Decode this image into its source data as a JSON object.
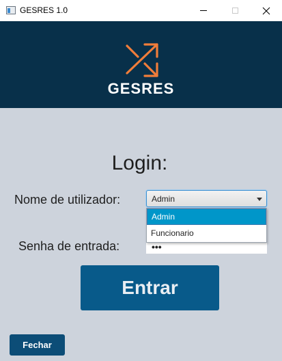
{
  "window": {
    "title": "GESRES 1.0",
    "controls": [
      "minimize-icon",
      "maximize-icon",
      "close-icon"
    ]
  },
  "header": {
    "logo_text": "GESRES",
    "logo_icon": "shuffle-arrows-icon",
    "background": "#08304a",
    "accent": "#f07d3a"
  },
  "login": {
    "title": "Login:",
    "username_label": "Nome de utilizador:",
    "username_selected": "Admin",
    "username_options": [
      "Admin",
      "Funcionario"
    ],
    "password_label": "Senha de entrada:",
    "password_value": "•••",
    "submit_label": "Entrar"
  },
  "footer": {
    "close_label": "Fechar"
  }
}
